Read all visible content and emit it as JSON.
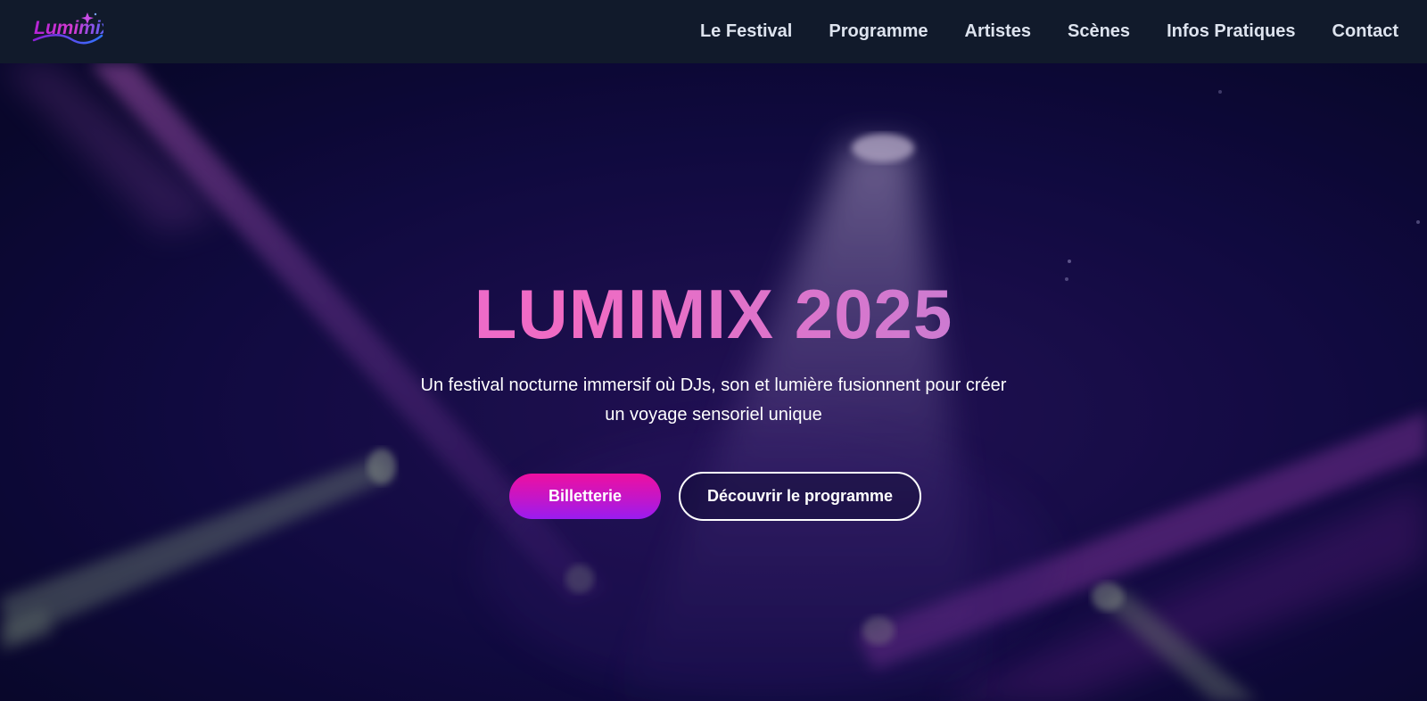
{
  "brand": {
    "logo_text": "Lumimix"
  },
  "nav": {
    "items": [
      {
        "label": "Le Festival"
      },
      {
        "label": "Programme"
      },
      {
        "label": "Artistes"
      },
      {
        "label": "Scènes"
      },
      {
        "label": "Infos Pratiques"
      },
      {
        "label": "Contact"
      }
    ]
  },
  "hero": {
    "title": "LUMIMIX 2025",
    "subtitle": "Un festival nocturne immersif où DJs, son et lumière fusionnent pour créer un voyage sensoriel unique",
    "primary_button": "Billetterie",
    "secondary_button": "Découvrir le programme"
  },
  "colors": {
    "navbar_bg": "#111a2b",
    "hero_bg": "#0b0a2e",
    "accent_pink": "#ee0fa0",
    "accent_purple": "#9a1cf0",
    "title_gradient_start": "#e56ae3",
    "title_gradient_end": "#9d86ec"
  }
}
